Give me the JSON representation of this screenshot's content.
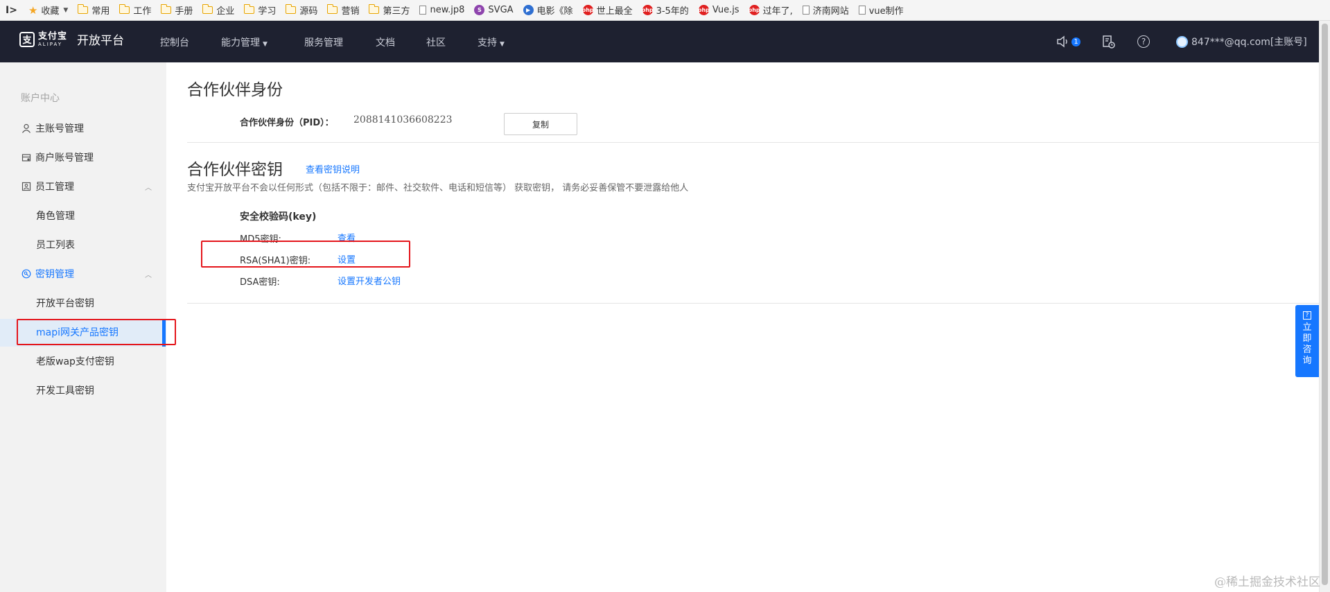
{
  "bookmarks": {
    "items": [
      {
        "label": "收藏",
        "icon": "star-icon",
        "type": "star"
      },
      {
        "label": "常用",
        "icon": "folder-icon",
        "type": "folder"
      },
      {
        "label": "工作",
        "icon": "folder-icon",
        "type": "folder"
      },
      {
        "label": "手册",
        "icon": "folder-icon",
        "type": "folder"
      },
      {
        "label": "企业",
        "icon": "folder-icon",
        "type": "folder"
      },
      {
        "label": "学习",
        "icon": "folder-icon",
        "type": "folder"
      },
      {
        "label": "源码",
        "icon": "folder-icon",
        "type": "folder"
      },
      {
        "label": "营销",
        "icon": "folder-icon",
        "type": "folder"
      },
      {
        "label": "第三方",
        "icon": "folder-icon",
        "type": "folder"
      },
      {
        "label": "new.jp8",
        "icon": "page-icon",
        "type": "page"
      },
      {
        "label": "SVGA",
        "icon": "svga-icon",
        "type": "circle",
        "color": "#8e44ad",
        "glyph": "S"
      },
      {
        "label": "电影《除",
        "icon": "movie-icon",
        "type": "circle",
        "color": "#2f6fd1",
        "glyph": "▶"
      },
      {
        "label": "世上最全",
        "icon": "php-icon",
        "type": "circle",
        "color": "#e02020",
        "glyph": "php"
      },
      {
        "label": "3-5年的",
        "icon": "php-icon",
        "type": "circle",
        "color": "#e02020",
        "glyph": "php"
      },
      {
        "label": "Vue.js",
        "icon": "php-icon",
        "type": "circle",
        "color": "#e02020",
        "glyph": "php"
      },
      {
        "label": "过年了,",
        "icon": "php-icon",
        "type": "circle",
        "color": "#e02020",
        "glyph": "php"
      },
      {
        "label": "济南网站",
        "icon": "page-icon",
        "type": "page"
      },
      {
        "label": "vue制作",
        "icon": "page-icon",
        "type": "page"
      }
    ]
  },
  "header": {
    "logo_cn": "支付宝",
    "logo_en": "ALIPAY",
    "title": "开放平台",
    "nav": {
      "console": "控制台",
      "capability": "能力管理",
      "service": "服务管理",
      "docs": "文档",
      "community": "社区",
      "support": "支持"
    },
    "notification_count": "1",
    "account": "847***@qq.com[主账号]"
  },
  "sidebar": {
    "heading": "账户中心",
    "main_account": "主账号管理",
    "merchant_account": "商户账号管理",
    "staff": "员工管理",
    "roles": "角色管理",
    "staff_list": "员工列表",
    "keys": "密钥管理",
    "open_platform_key": "开放平台密钥",
    "mapi_key": "mapi网关产品密钥",
    "old_wap_key": "老版wap支付密钥",
    "dev_tool_key": "开发工具密钥"
  },
  "main": {
    "identity_title": "合作伙伴身份",
    "pid_label": "合作伙伴身份（PID）：",
    "pid_value": "2088141036608223",
    "copy_button": "复制",
    "key_title": "合作伙伴密钥",
    "key_doc_link": "查看密钥说明",
    "notice": "支付宝开放平台不会以任何形式（包括不限于：邮件、社交软件、电话和短信等） 获取密钥， 请务必妥善保管不要泄露给他人",
    "security_key_title": "安全校验码(key)",
    "md5_label": "MD5密钥:",
    "md5_action": "查看",
    "rsa_label": "RSA(SHA1)密钥:",
    "rsa_action": "设置",
    "dsa_label": "DSA密钥:",
    "dsa_action": "设置开发者公钥"
  },
  "consult": {
    "label": "立即咨询",
    "icon": "question-icon"
  },
  "watermark": "@稀土掘金技术社区",
  "colors": {
    "nav_bg": "#1e2130",
    "accent": "#1677ff",
    "sidebar_bg": "#f2f2f2",
    "highlight_box": "#e4151b"
  }
}
